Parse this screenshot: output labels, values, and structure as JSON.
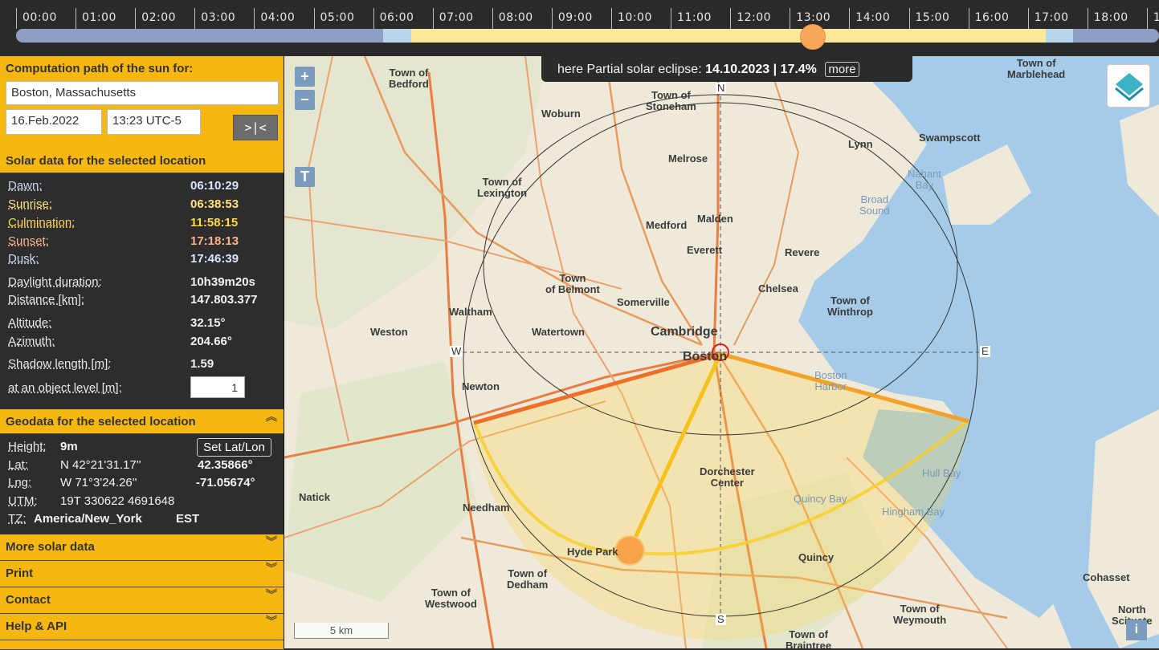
{
  "timeline": {
    "hours": [
      "00:00",
      "01:00",
      "02:00",
      "03:00",
      "04:00",
      "05:00",
      "06:00",
      "07:00",
      "08:00",
      "09:00",
      "10:00",
      "11:00",
      "12:00",
      "13:00",
      "14:00",
      "15:00",
      "16:00",
      "17:00",
      "18:00",
      "1"
    ]
  },
  "location_panel": {
    "header": "Computation path of the sun for:",
    "location": "Boston, Massachusetts",
    "date": "16.Feb.2022",
    "time": "13:23 UTC-5",
    "now_button": ">|<"
  },
  "solar_panel": {
    "header": "Solar data for the selected location",
    "dawn_label": "Dawn:",
    "dawn": "06:10:29",
    "sunrise_label": "Sunrise:",
    "sunrise": "06:38:53",
    "culmination_label": "Culmination:",
    "culmination": "11:58:15",
    "sunset_label": "Sunset:",
    "sunset": "17:18:13",
    "dusk_label": "Dusk:",
    "dusk": "17:46:39",
    "daylight_label": "Daylight duration:",
    "daylight": "10h39m20s",
    "distance_label": "Distance [km]:",
    "distance": "147.803.377",
    "altitude_label": "Altitude:",
    "altitude": "32.15°",
    "azimuth_label": "Azimuth:",
    "azimuth": "204.66°",
    "shadow_label": "Shadow length [m]:",
    "shadow": "1.59",
    "object_level_label": "at an object level [m]:",
    "object_level": "1"
  },
  "geo_panel": {
    "header": "Geodata for the selected location",
    "height_label": "Height:",
    "height": "9m",
    "set_latlon": "Set Lat/Lon",
    "lat_label": "Lat:",
    "lat_dms": "N 42°21'31.17''",
    "lat_dec": "42.35866°",
    "lng_label": "Lng:",
    "lng_dms": "W 71°3'24.26''",
    "lng_dec": "-71.05674°",
    "utm_label": "UTM:",
    "utm": "19T 330622 4691648",
    "tz_label": "TZ:",
    "tz": "America/New_York",
    "tz_abbr": "EST"
  },
  "menu": [
    "More solar data",
    "Print",
    "Contact",
    "Help & API"
  ],
  "map": {
    "zoom_in": "+",
    "zoom_out": "−",
    "t_button": "T",
    "eclipse_prefix": "here Partial solar eclipse:",
    "eclipse_value": "14.10.2023 | 17.4%",
    "more": "more",
    "scale": "5 km",
    "info": "i",
    "compass": {
      "n": "N",
      "s": "S",
      "e": "E",
      "w": "W"
    },
    "places": {
      "bedford": "Town of\nBedford",
      "stoneham": "Town of\nStoneham",
      "woburn": "Woburn",
      "marblehead": "Town of\nMarblehead",
      "swampscott": "Swampscott",
      "lynn": "Lynn",
      "melrose": "Melrose",
      "lexington": "Town of\nLexington",
      "malden": "Malden",
      "medford": "Medford",
      "nahant": "Nahant\nBay",
      "broad": "Broad\nSound",
      "everett": "Everett",
      "revere": "Revere",
      "belmont": "Town\nof Belmont",
      "chelsea": "Chelsea",
      "somerville": "Somerville",
      "winthrop": "Town of\nWinthrop",
      "waltham": "Waltham",
      "weston": "Weston",
      "watertown": "Watertown",
      "cambridge": "Cambridge",
      "boston": "Boston",
      "harbor": "Boston\nHarbor",
      "newton": "Newton",
      "dorchester": "Dorchester\nCenter",
      "hull": "Hull Bay",
      "quincybay": "Quincy Bay",
      "hingham": "Hingham Bay",
      "natick": "Natick",
      "needham": "Needham",
      "hydepark": "Hyde Park",
      "quincy": "Quincy",
      "dedham": "Town of\nDedham",
      "westwood": "Town of\nWestwood",
      "cohasset": "Cohasset",
      "weymouth": "Town of\nWeymouth",
      "braintree": "Town of\nBraintree",
      "north": "North\nScituate"
    }
  },
  "colors": {
    "accent": "#f6b711",
    "panel_bg": "#2d2d2d",
    "sunrise": "#ffe27a",
    "culmination": "#ffd84d",
    "sunset": "#ffb08a",
    "day_track": "#fbe89a",
    "twilight_track": "#b7d6ec",
    "night_track": "#8f9fc4",
    "sun": "#f9a85a"
  }
}
